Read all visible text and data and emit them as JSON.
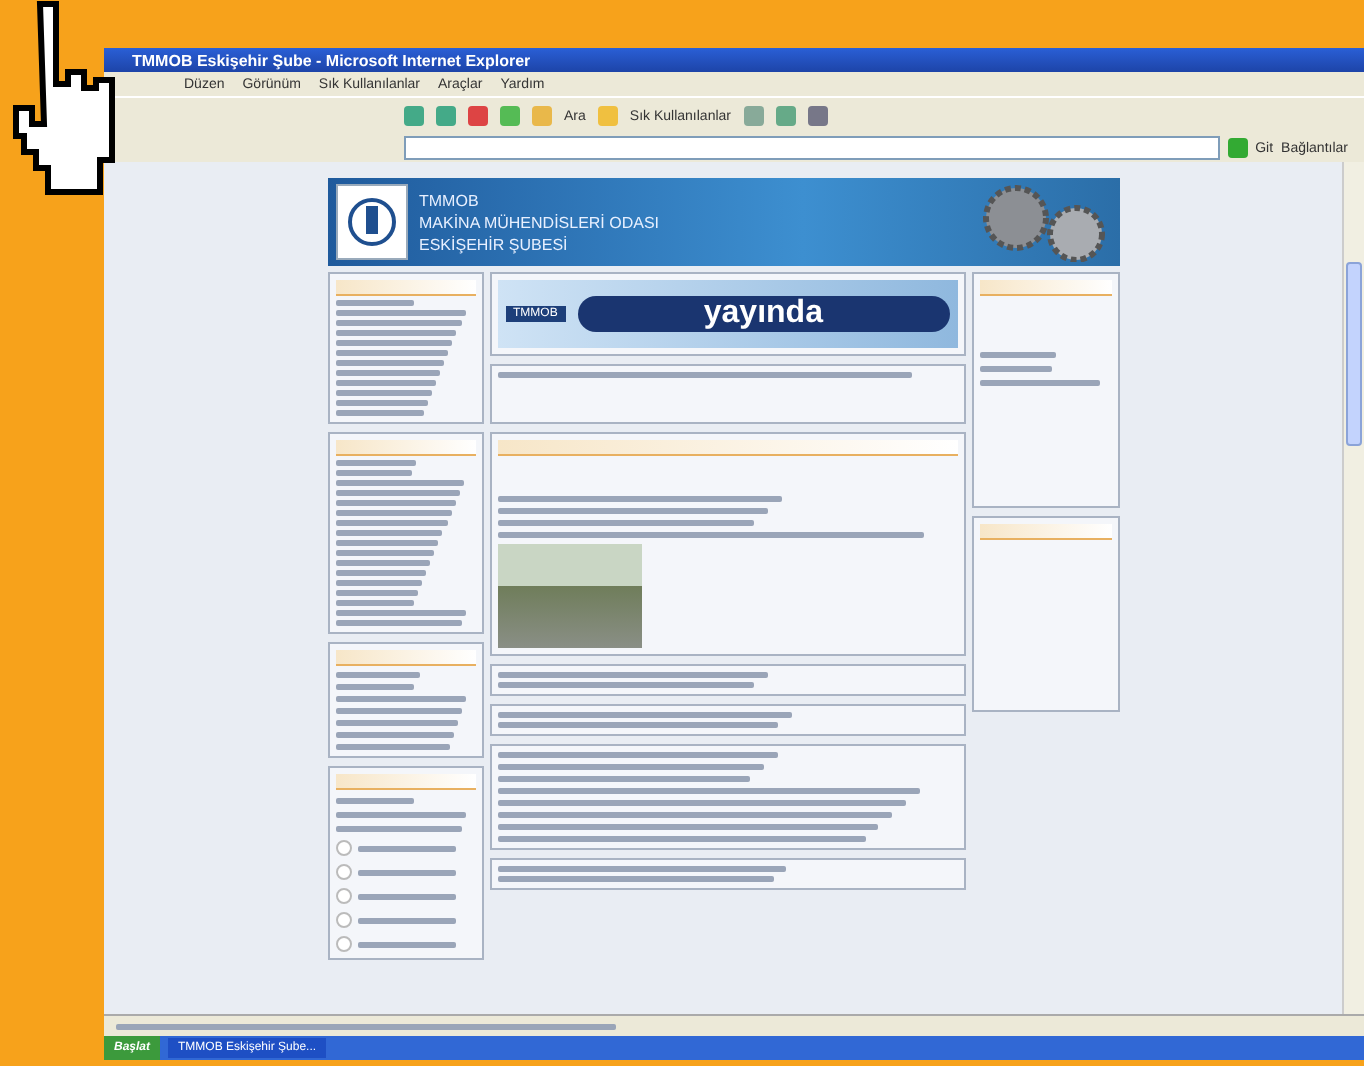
{
  "window": {
    "title": "TMMOB Eskişehir Şube - Microsoft Internet Explorer"
  },
  "menu": [
    "Düzen",
    "Görünüm",
    "Sık Kullanılanlar",
    "Araçlar",
    "Yardım"
  ],
  "toolbar": {
    "search": "Ara",
    "favorites": "Sık Kullanılanlar"
  },
  "address_bar": {
    "go": "Git",
    "links": "Bağlantılar"
  },
  "site": {
    "org": "TMMOB",
    "chamber": "MAKİNA MÜHENDİSLERİ ODASI",
    "branch": "ESKİŞEHİR ŞUBESİ"
  },
  "banner": {
    "badge": "TMMOB",
    "word": "yayında"
  },
  "poll": {
    "options": [
      {
        "selected": false
      },
      {
        "selected": false
      },
      {
        "selected": false
      },
      {
        "selected": false
      },
      {
        "selected": false
      }
    ]
  },
  "taskbar": {
    "start": "Başlat",
    "task": "TMMOB Eskişehir Şube..."
  }
}
